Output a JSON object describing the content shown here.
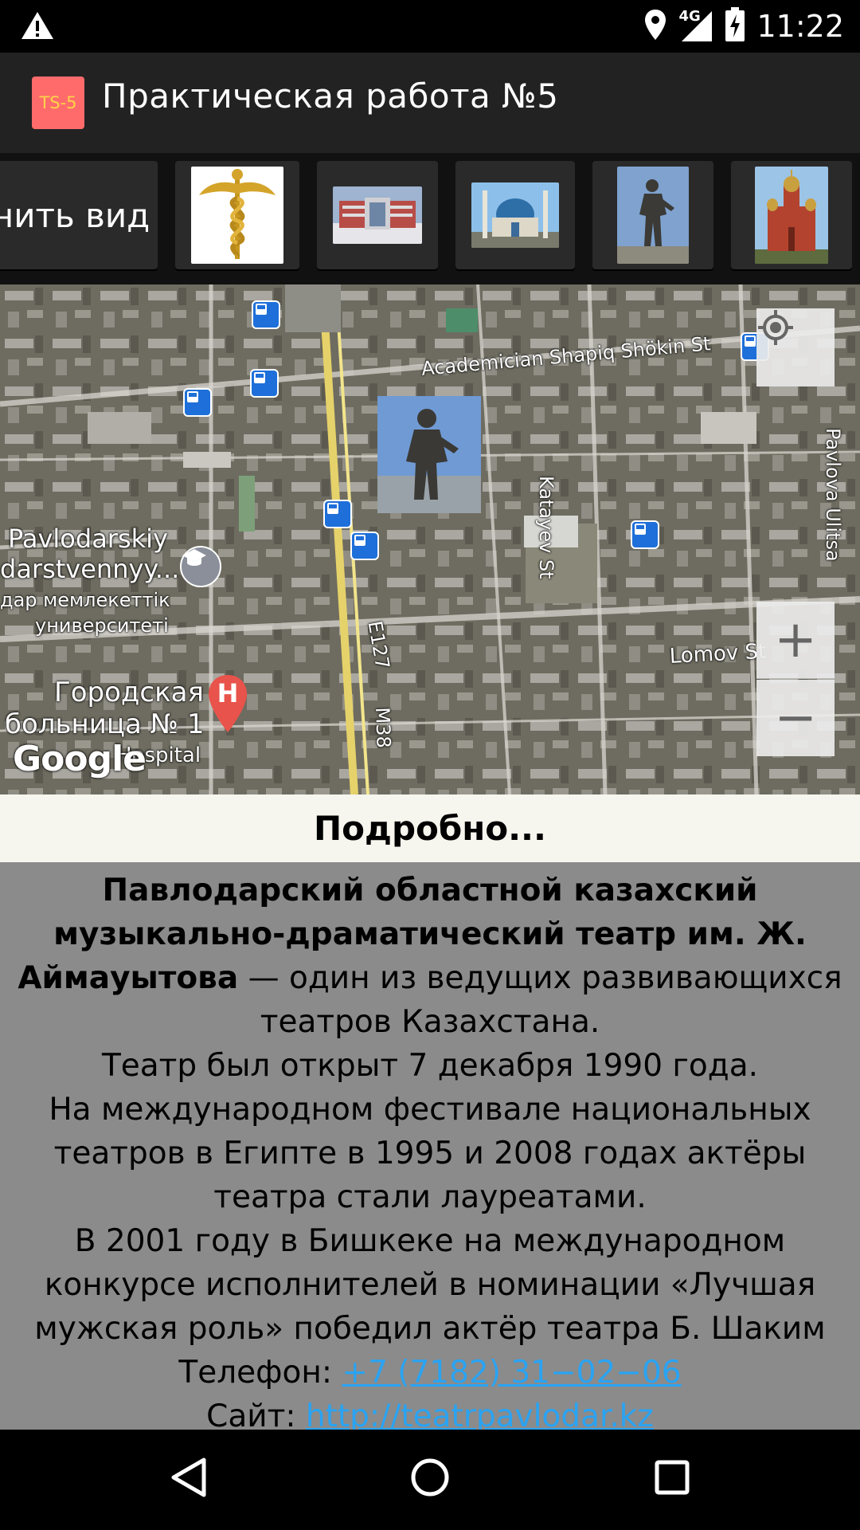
{
  "status_bar": {
    "time": "11:22",
    "network": "4G",
    "icons": [
      "warning-icon",
      "location-icon",
      "signal-icon",
      "battery-charging-icon"
    ]
  },
  "app_bar": {
    "logo_text": "TS-5",
    "title": "Практическая работа №5"
  },
  "toolbar": {
    "change_view_label": "нить вид",
    "thumbnails": [
      "caduceus-thumb",
      "hospital-building-thumb",
      "mosque-thumb",
      "statue-thumb",
      "cathedral-thumb"
    ]
  },
  "map": {
    "labels": {
      "street1": "Academician Shapiq Shökin St",
      "street2": "Katayev St",
      "street3": "Pavlova Ulitsa",
      "street4": "Lomov St",
      "road1": "E127",
      "road2": "M38",
      "uni_line1": "Pavlodarskiy",
      "uni_line2": "darstvennyy...",
      "uni_line3": "дар мемлекеттік",
      "uni_line4": "университеті",
      "hosp_line1": "Городская",
      "hosp_line2": "больница № 1",
      "hosp_line3": "Hospital",
      "google": "Google"
    },
    "hospital_pin_letter": "H",
    "zoom_in": "+",
    "zoom_out": "−"
  },
  "details": {
    "label": "Подробно..."
  },
  "info": {
    "bold_title": "Павлодарский областной казахский музыкально-драматический театр им. Ж. Аймауытова",
    "intro_rest": " — один из ведущих развивающихся театров Казахстана.",
    "p1": "Театр был открыт 7 декабря 1990 года.",
    "p2": "На международном фестивале национальных театров в Египте в 1995 и 2008 годах актёры театра стали лауреатами.",
    "p3": "В 2001 году в Бишкеке на международном конкурсе исполнителей в номинации «Лучшая мужская роль» победил актёр театра Б. Шаким",
    "phone_label": "Телефон: ",
    "phone": "+7 (7182) 31−02−06",
    "site_label": "Сайт: ",
    "site": "http://teatrpavlodar.kz"
  }
}
